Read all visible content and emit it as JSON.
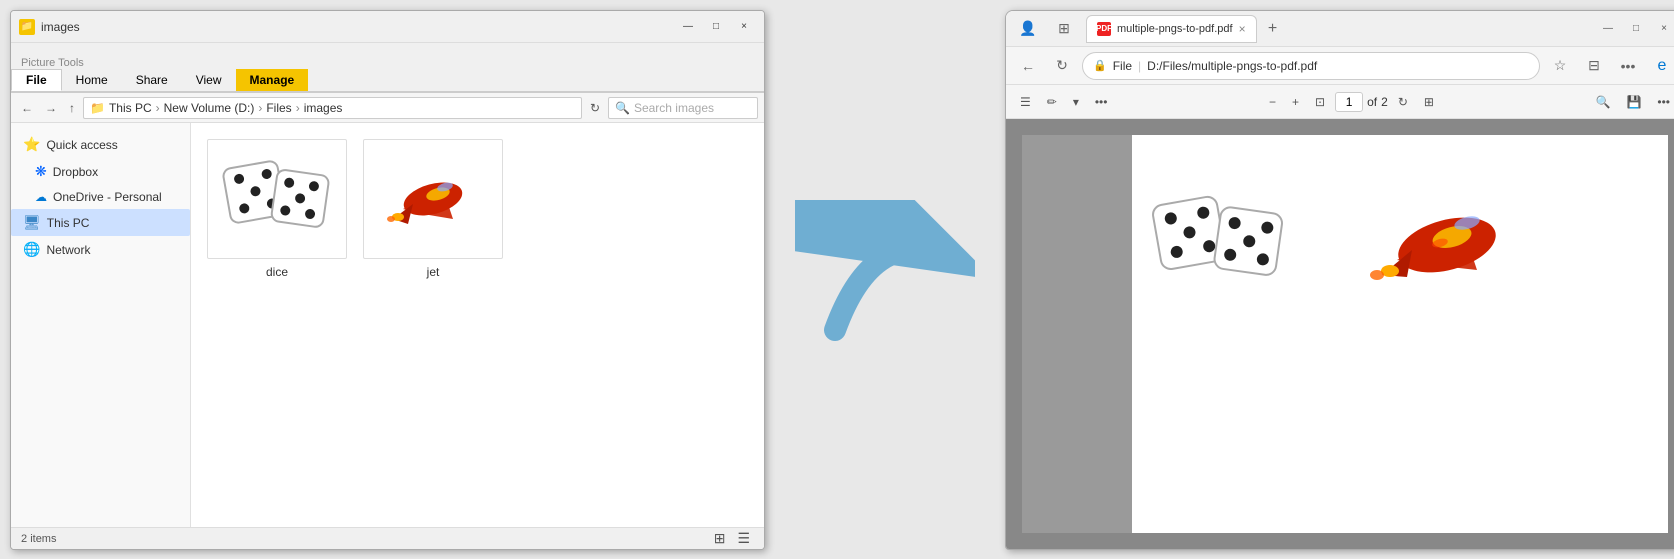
{
  "explorer": {
    "title": "images",
    "title_icon": "folder",
    "tabs": [
      "File",
      "Home",
      "Share",
      "View",
      "Picture Tools"
    ],
    "active_tab": "Manage",
    "manage_label": "Manage",
    "picture_tools_label": "Picture Tools",
    "breadcrumb": [
      "This PC",
      "New Volume (D:)",
      "Files",
      "images"
    ],
    "search_placeholder": "Search images",
    "sidebar": {
      "items": [
        {
          "label": "Quick access",
          "icon": "quickaccess"
        },
        {
          "label": "Dropbox",
          "icon": "dropbox"
        },
        {
          "label": "OneDrive - Personal",
          "icon": "onedrive"
        },
        {
          "label": "This PC",
          "icon": "thispc",
          "active": true
        },
        {
          "label": "Network",
          "icon": "network"
        }
      ]
    },
    "files": [
      {
        "name": "dice",
        "type": "image"
      },
      {
        "name": "jet",
        "type": "image"
      }
    ],
    "status": {
      "count": "2",
      "unit": "items"
    }
  },
  "browser": {
    "tab_title": "multiple-pngs-to-pdf.pdf",
    "tab_close": "×",
    "new_tab": "+",
    "win_min": "—",
    "win_max": "□",
    "win_close": "×",
    "back_btn": "←",
    "refresh_btn": "↻",
    "url_label": "File",
    "url_path": "D:/Files/multiple-pngs-to-pdf.pdf",
    "toolbar": {
      "menu1": "☰",
      "annotate": "✏",
      "more": "•••",
      "zoom_out": "−",
      "zoom_in": "+",
      "fit": "⊡",
      "current_page": "1",
      "total_pages": "2",
      "rotate": "↻",
      "spread": "⊞",
      "search": "🔍",
      "save": "💾",
      "more2": "•••"
    }
  },
  "arrow": {
    "color": "#5ba4cf"
  },
  "icons": {
    "quickaccess": "⭐",
    "dropbox": "❋",
    "onedrive": "☁",
    "thispc": "💻",
    "network": "🖧",
    "search": "🔍",
    "folder": "📁"
  }
}
